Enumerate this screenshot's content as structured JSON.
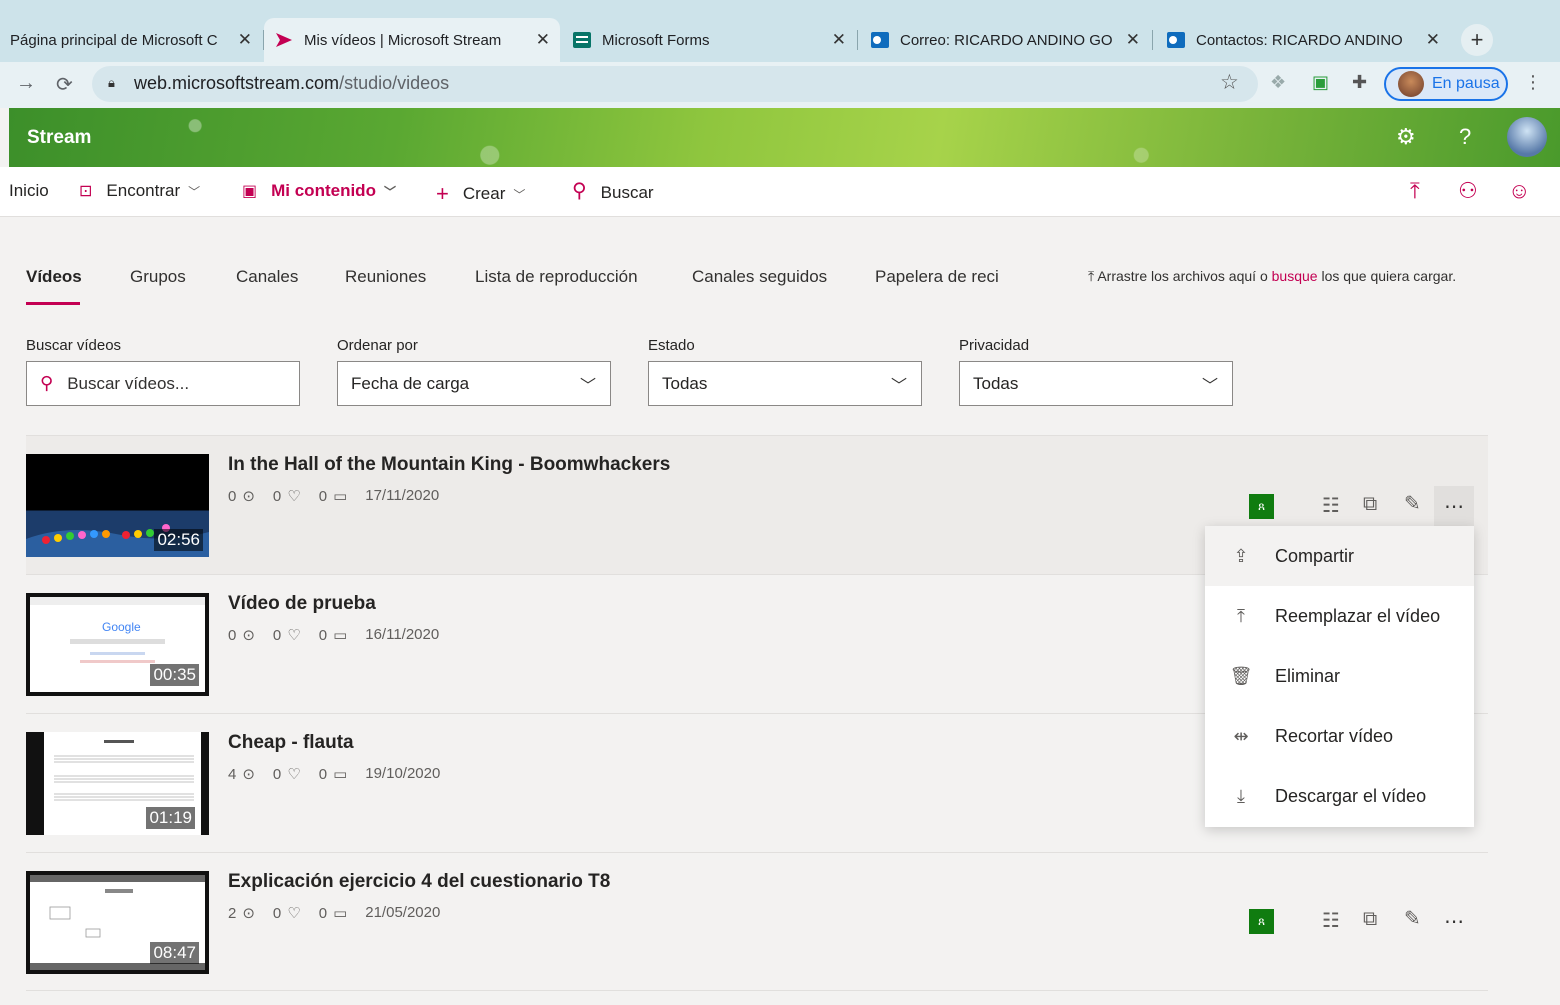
{
  "browser": {
    "tabs": [
      {
        "title": "Página principal de Microsoft C",
        "favicon": "office-icon"
      },
      {
        "title": "Mis vídeos | Microsoft Stream",
        "favicon": "stream-icon"
      },
      {
        "title": "Microsoft Forms",
        "favicon": "forms-icon"
      },
      {
        "title": "Correo: RICARDO ANDINO GO",
        "favicon": "outlook-icon"
      },
      {
        "title": "Contactos: RICARDO ANDINO",
        "favicon": "outlook-icon"
      }
    ],
    "url_host": "web.microsoftstream.com",
    "url_path": "/studio/videos",
    "profile_label": "En pausa"
  },
  "app": {
    "brand": "Stream",
    "nav": {
      "home": "Inicio",
      "discover": "Encontrar",
      "my_content": "Mi contenido",
      "create": "Crear",
      "search": "Buscar"
    }
  },
  "tabs": [
    "Vídeos",
    "Grupos",
    "Canales",
    "Reuniones",
    "Lista de reproducción",
    "Canales seguidos",
    "Papelera de reci"
  ],
  "upload_hint": {
    "prefix": "Arrastre los archivos aquí o",
    "link": "busque",
    "suffix": "los que quiera cargar."
  },
  "filters": {
    "search_label": "Buscar vídeos",
    "search_placeholder": "Buscar vídeos...",
    "sort_label": "Ordenar por",
    "sort_value": "Fecha de carga",
    "status_label": "Estado",
    "status_value": "Todas",
    "privacy_label": "Privacidad",
    "privacy_value": "Todas"
  },
  "videos": [
    {
      "title": "In the Hall of the Mountain King - Boomwhackers",
      "views": "0",
      "likes": "0",
      "comments": "0",
      "date": "17/11/2020",
      "duration": "02:56"
    },
    {
      "title": "Vídeo de prueba",
      "views": "0",
      "likes": "0",
      "comments": "0",
      "date": "16/11/2020",
      "duration": "00:35"
    },
    {
      "title": "Cheap - flauta",
      "views": "4",
      "likes": "0",
      "comments": "0",
      "date": "19/10/2020",
      "duration": "01:19"
    },
    {
      "title": "Explicación ejercicio 4 del cuestionario T8",
      "views": "2",
      "likes": "0",
      "comments": "0",
      "date": "21/05/2020",
      "duration": "08:47"
    }
  ],
  "context_menu": [
    "Compartir",
    "Reemplazar el vídeo",
    "Eliminar",
    "Recortar vídeo",
    "Descargar el vídeo"
  ],
  "colors": {
    "accent": "#c30052",
    "banner": "#79b43a",
    "badge_green": "#107c10"
  }
}
